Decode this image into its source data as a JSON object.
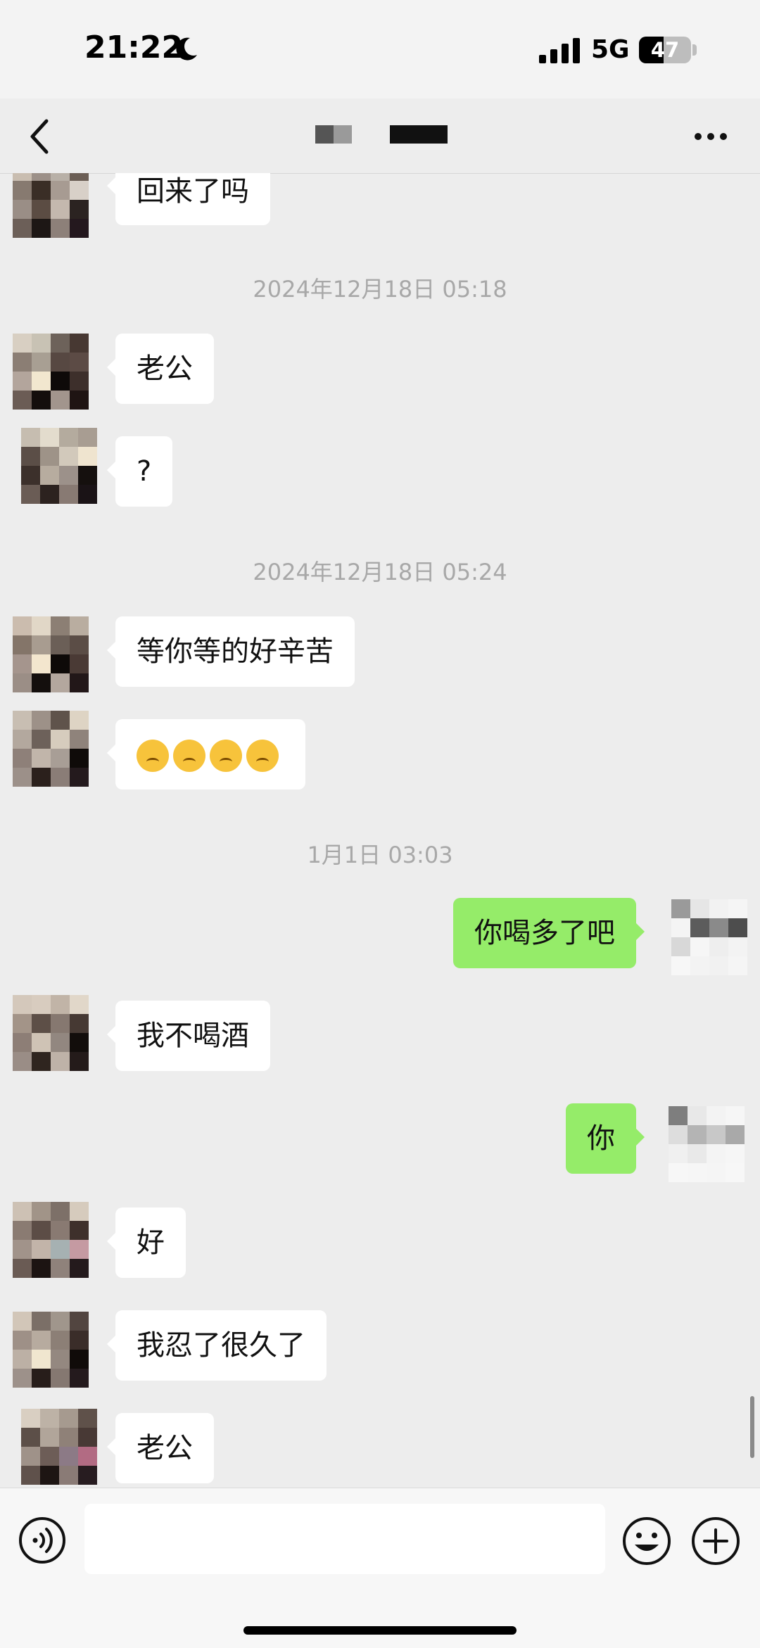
{
  "status_bar": {
    "time": "21:22",
    "network": "5G",
    "battery_level": "47",
    "moon_icon": "moon-icon",
    "signal_icon": "cellular-signal-icon"
  },
  "nav": {
    "back_icon": "chevron-left-icon",
    "more_icon": "more-dots-icon"
  },
  "timestamps": [
    "2024年12月18日 05:18",
    "2024年12月18日 05:24",
    "1月1日 03:03"
  ],
  "messages": [
    {
      "side": "left",
      "text": "回来了吗"
    },
    {
      "side": "left",
      "text": "老公"
    },
    {
      "side": "left",
      "text": "?"
    },
    {
      "side": "left",
      "text": "等你等的好辛苦"
    },
    {
      "side": "left",
      "emoji_count": 4,
      "emoji_icon": "pleading-face-emoji"
    },
    {
      "side": "right",
      "text": "你喝多了吧"
    },
    {
      "side": "left",
      "text": "我不喝酒"
    },
    {
      "side": "right",
      "text": "你"
    },
    {
      "side": "left",
      "text": "好"
    },
    {
      "side": "left",
      "text": "我忍了很久了"
    },
    {
      "side": "left",
      "text": "老公"
    }
  ],
  "input_bar": {
    "voice_icon": "voice-input-icon",
    "emoji_icon": "emoji-smile-icon",
    "plus_icon": "plus-circle-icon",
    "text_value": ""
  },
  "colors": {
    "background": "#ededed",
    "incoming_bubble": "#ffffff",
    "outgoing_bubble": "#95ec69",
    "timestamp_text": "#a8a8a8"
  }
}
